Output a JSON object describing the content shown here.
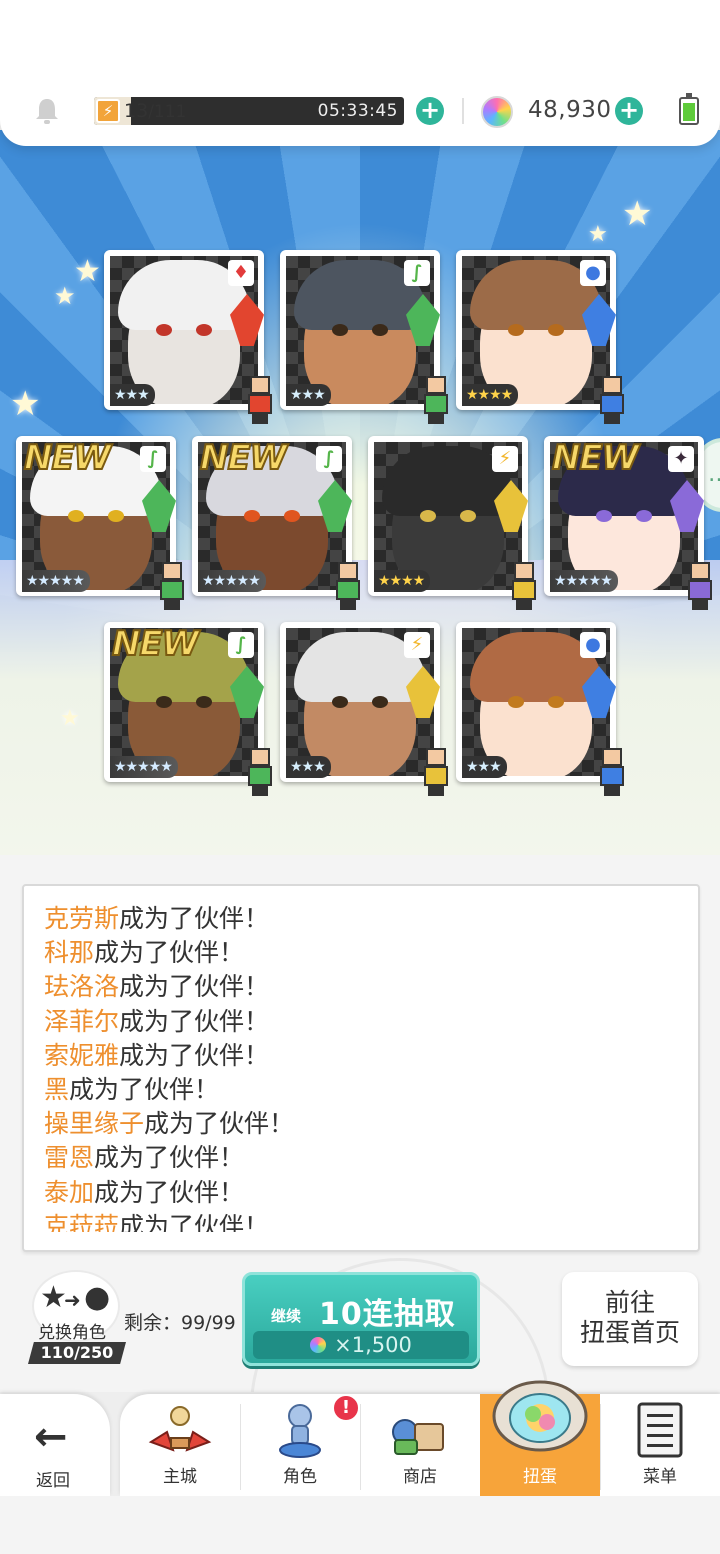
{
  "status": {
    "stamina_current": "13",
    "stamina_max": "/111",
    "stamina_fill": 0.12,
    "stamina_timer": "05:33:45",
    "gem_count": "48,930"
  },
  "colors": {
    "accent": "#2fb59a",
    "name_highlight": "#ee8f2e",
    "active_tab": "#f7a43a",
    "pull_button": "#2ba89c"
  },
  "cards": [
    {
      "rarity": "★★★",
      "element": "♦",
      "element_color": "#e23b3b",
      "new": "",
      "hair": "#f1f1f1",
      "skin": "#e8e4e0",
      "eye": "#c2362a",
      "crystal": "#e2452f"
    },
    {
      "rarity": "★★★",
      "element": "∫",
      "element_color": "#55b54a",
      "new": "",
      "hair": "#4d5560",
      "skin": "#c98a5e",
      "eye": "#3b2a1a",
      "crystal": "#4db65a"
    },
    {
      "rarity": "★★★★",
      "element": "●",
      "element_color": "#3d78e0",
      "new": "",
      "hair": "#9c6b48",
      "skin": "#fbe1cf",
      "eye": "#b56b1e",
      "crystal": "#3f7fe2"
    },
    {
      "rarity": "★★★★★",
      "element": "∫",
      "element_color": "#55b54a",
      "new": "NEW",
      "hair": "#f4f4f4",
      "skin": "#8a5a3a",
      "eye": "#e0b020",
      "crystal": "#4db65a"
    },
    {
      "rarity": "★★★★★",
      "element": "∫",
      "element_color": "#55b54a",
      "new": "NEW",
      "hair": "#d8d8de",
      "skin": "#7c4a2e",
      "eye": "#e0551f",
      "crystal": "#4db65a"
    },
    {
      "rarity": "★★★★",
      "element": "⚡",
      "element_color": "#f2b529",
      "new": "",
      "hair": "#2a2a2a",
      "skin": "#3a3a3a",
      "eye": "#d8b84a",
      "crystal": "#e8c23a"
    },
    {
      "rarity": "★★★★★",
      "element": "✦",
      "element_color": "#3a2a3a",
      "new": "NEW",
      "hair": "#2c2a4a",
      "skin": "#fde7dc",
      "eye": "#8a6ad8",
      "crystal": "#8a6ad8"
    },
    {
      "rarity": "★★★★★",
      "element": "∫",
      "element_color": "#55b54a",
      "new": "NEW",
      "hair": "#a4a34a",
      "skin": "#8a5a38",
      "eye": "#3a2a1a",
      "crystal": "#4db65a"
    },
    {
      "rarity": "★★★",
      "element": "⚡",
      "element_color": "#f2b529",
      "new": "",
      "hair": "#e4e4e4",
      "skin": "#c28a64",
      "eye": "#3a2a1a",
      "crystal": "#e8c23a"
    },
    {
      "rarity": "★★★",
      "element": "●",
      "element_color": "#3d78e0",
      "new": "",
      "hair": "#b06a44",
      "skin": "#fbe1cf",
      "eye": "#c27a1e",
      "crystal": "#3f7fe2"
    }
  ],
  "log": [
    {
      "name": "克劳斯",
      "suffix": "成为了伙伴！"
    },
    {
      "name": "科那",
      "suffix": "成为了伙伴！"
    },
    {
      "name": "珐洛洛",
      "suffix": "成为了伙伴！"
    },
    {
      "name": "泽菲尔",
      "suffix": "成为了伙伴！"
    },
    {
      "name": "索妮雅",
      "suffix": "成为了伙伴！"
    },
    {
      "name": "黑",
      "suffix": "成为了伙伴！"
    },
    {
      "name": "操里缘子",
      "suffix": "成为了伙伴！"
    },
    {
      "name": "雷恩",
      "suffix": "成为了伙伴！"
    },
    {
      "name": "泰加",
      "suffix": "成为了伙伴！"
    },
    {
      "name": "克菈菈",
      "suffix": "成为了伙伴！"
    }
  ],
  "actions": {
    "exchange_label": "兑换角色",
    "exchange_count": "110/250",
    "remaining": "剩余：99/99",
    "pull_continue": "继续",
    "pull_title": "10连抽取",
    "pull_cost": "×1,500",
    "gacha_home_line1": "前往",
    "gacha_home_line2": "扭蛋首页"
  },
  "nav": {
    "back": "返回",
    "items": [
      {
        "label": "主城",
        "icon": "castle-icon"
      },
      {
        "label": "角色",
        "icon": "character-icon",
        "badge": "!"
      },
      {
        "label": "商店",
        "icon": "shop-icon"
      },
      {
        "label": "扭蛋",
        "icon": "gacha-icon",
        "active": true
      },
      {
        "label": "菜单",
        "icon": "menu-icon"
      }
    ]
  }
}
